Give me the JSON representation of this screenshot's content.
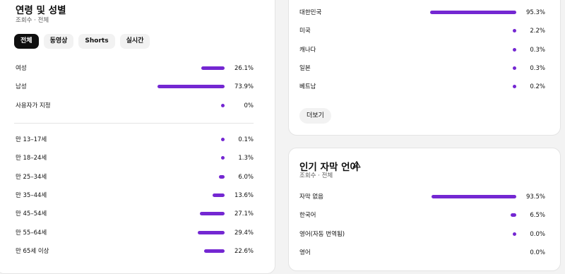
{
  "age_gender": {
    "title": "연령 및 성별",
    "subtitle": "조회수 · 전체",
    "tabs": [
      {
        "label": "전체",
        "active": true
      },
      {
        "label": "동영상",
        "active": false
      },
      {
        "label": "Shorts",
        "active": false
      },
      {
        "label": "실시간",
        "active": false
      }
    ],
    "gender": [
      {
        "label": "여성",
        "value": "26.1%",
        "pct": 26.1
      },
      {
        "label": "남성",
        "value": "73.9%",
        "pct": 73.9
      },
      {
        "label": "사용자가 지정",
        "value": "0%",
        "pct": 0
      }
    ],
    "age": [
      {
        "label": "만 13–17세",
        "value": "0.1%",
        "pct": 0.1
      },
      {
        "label": "만 18–24세",
        "value": "1.3%",
        "pct": 1.3
      },
      {
        "label": "만 25–34세",
        "value": "6.0%",
        "pct": 6.0
      },
      {
        "label": "만 35–44세",
        "value": "13.6%",
        "pct": 13.6
      },
      {
        "label": "만 45–54세",
        "value": "27.1%",
        "pct": 27.1
      },
      {
        "label": "만 55–64세",
        "value": "29.4%",
        "pct": 29.4
      },
      {
        "label": "만 65세 이상",
        "value": "22.6%",
        "pct": 22.6
      }
    ]
  },
  "geography": {
    "rows": [
      {
        "label": "대한민국",
        "value": "95.3%",
        "pct": 95.3
      },
      {
        "label": "미국",
        "value": "2.2%",
        "pct": 2.2
      },
      {
        "label": "캐나다",
        "value": "0.3%",
        "pct": 0.3
      },
      {
        "label": "일본",
        "value": "0.3%",
        "pct": 0.3
      },
      {
        "label": "베트남",
        "value": "0.2%",
        "pct": 0.2
      }
    ],
    "more_label": "더보기"
  },
  "subtitles": {
    "title": "인기 자막 언어",
    "subtitle": "조회수 · 전체",
    "icon": "warning-icon",
    "rows": [
      {
        "label": "자막 없음",
        "value": "93.5%",
        "pct": 93.5
      },
      {
        "label": "한국어",
        "value": "6.5%",
        "pct": 6.5
      },
      {
        "label": "영어(자동 번역됨)",
        "value": "0.0%",
        "pct": 0.0
      },
      {
        "label": "영어",
        "value": "0.0%",
        "pct": 0.0
      }
    ]
  },
  "colors": {
    "bar": "#7427d2",
    "active_chip": "#0f0f0f",
    "chip": "#f2f2f2"
  }
}
